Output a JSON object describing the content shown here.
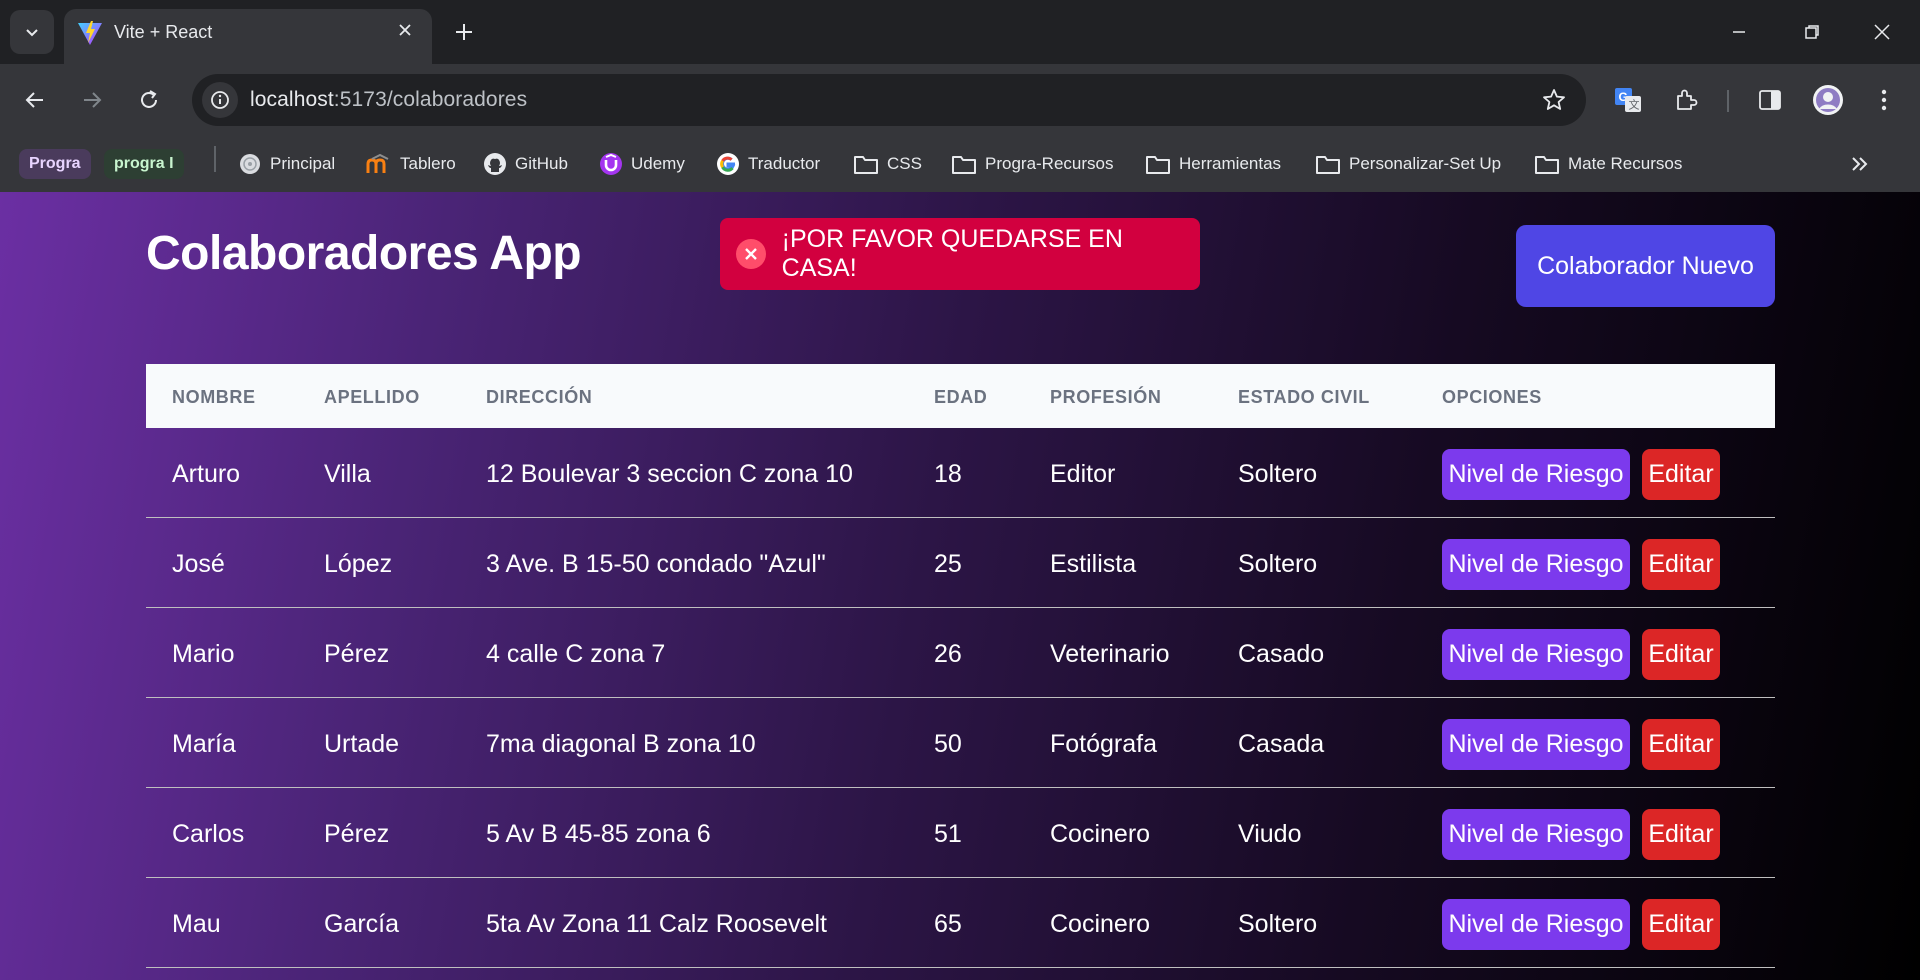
{
  "browser": {
    "tab_title": "Vite + React",
    "url_host": "localhost",
    "url_path": ":5173/colaboradores",
    "bookmarks": [
      {
        "label": "Progra",
        "type": "chip",
        "bg": "#4a3b5c",
        "color": "#e8d4ff"
      },
      {
        "label": "progra I",
        "type": "chip",
        "bg": "#2d3f33",
        "color": "#c8f5cf"
      },
      {
        "label": "Principal",
        "icon": "globe-icon"
      },
      {
        "label": "Tablero",
        "icon": "moodle-icon"
      },
      {
        "label": "GitHub",
        "icon": "github-icon"
      },
      {
        "label": "Udemy",
        "icon": "udemy-icon"
      },
      {
        "label": "Traductor",
        "icon": "google-icon"
      },
      {
        "label": "CSS",
        "icon": "folder-icon"
      },
      {
        "label": "Progra-Recursos",
        "icon": "folder-icon"
      },
      {
        "label": "Herramientas",
        "icon": "folder-icon"
      },
      {
        "label": "Personalizar-Set Up",
        "icon": "folder-icon"
      },
      {
        "label": "Mate Recursos",
        "icon": "folder-icon"
      }
    ]
  },
  "app": {
    "title": "Colaboradores App",
    "alert": "¡POR FAVOR QUEDARSE EN CASA!",
    "new_button": "Colaborador Nuevo",
    "colors": {
      "alert": "#d2003f",
      "primary": "#4f46e5",
      "risk": "#7c3aed",
      "edit": "#dc2626"
    }
  },
  "table": {
    "headers": [
      "NOMBRE",
      "APELLIDO",
      "DIRECCIÓN",
      "EDAD",
      "PROFESIÓN",
      "ESTADO CIVIL",
      "OPCIONES"
    ],
    "risk_label": "Nivel de Riesgo",
    "edit_label": "Editar",
    "rows": [
      {
        "nombre": "Arturo",
        "apellido": "Villa",
        "direccion": "12 Boulevar 3 seccion C zona 10",
        "edad": "18",
        "profesion": "Editor",
        "estado": "Soltero"
      },
      {
        "nombre": "José",
        "apellido": "López",
        "direccion": "3 Ave. B 15-50 condado \"Azul\"",
        "edad": "25",
        "profesion": "Estilista",
        "estado": "Soltero"
      },
      {
        "nombre": "Mario",
        "apellido": "Pérez",
        "direccion": "4 calle C zona 7",
        "edad": "26",
        "profesion": "Veterinario",
        "estado": "Casado"
      },
      {
        "nombre": "María",
        "apellido": "Urtade",
        "direccion": "7ma diagonal B zona 10",
        "edad": "50",
        "profesion": "Fotógrafa",
        "estado": "Casada"
      },
      {
        "nombre": "Carlos",
        "apellido": "Pérez",
        "direccion": "5 Av B 45-85 zona 6",
        "edad": "51",
        "profesion": "Cocinero",
        "estado": "Viudo"
      },
      {
        "nombre": "Mau",
        "apellido": "García",
        "direccion": "5ta Av Zona 11 Calz Roosevelt",
        "edad": "65",
        "profesion": "Cocinero",
        "estado": "Soltero"
      }
    ]
  }
}
